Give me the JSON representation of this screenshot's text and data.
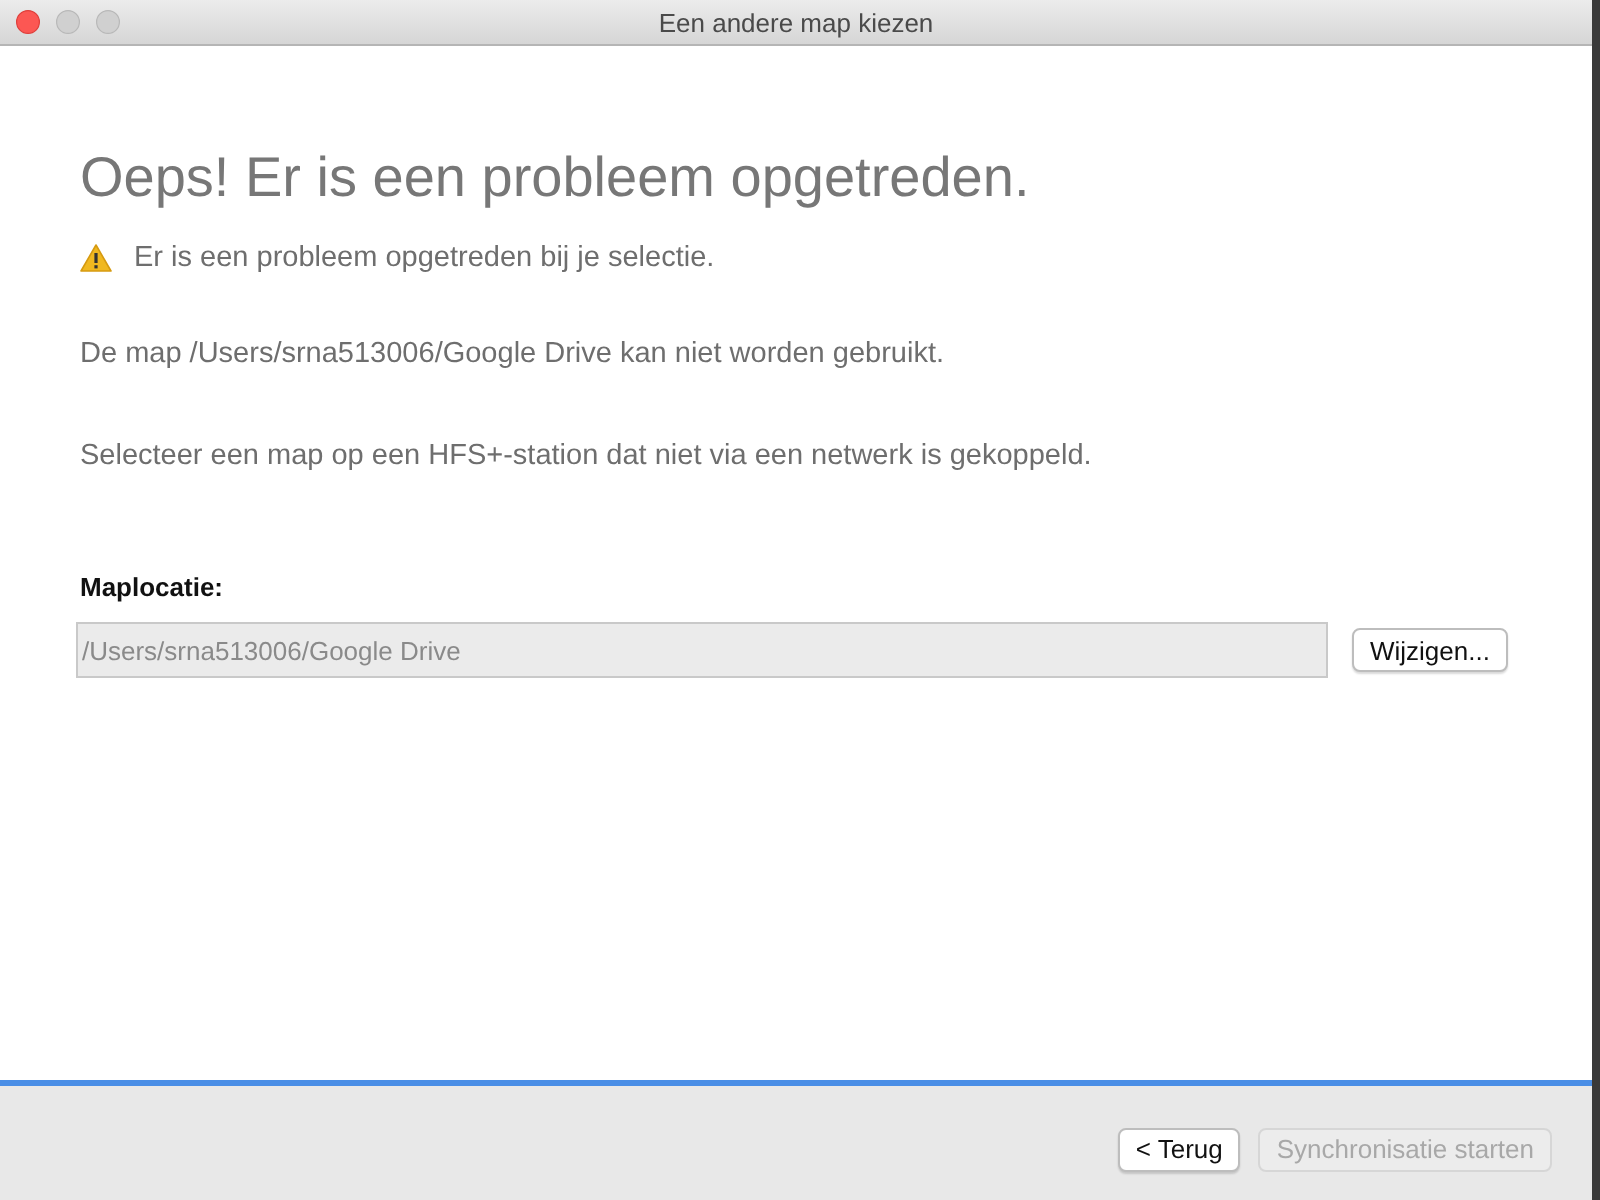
{
  "window": {
    "title": "Een andere map kiezen"
  },
  "heading": "Oeps! Er is een probleem opgetreden.",
  "warning": "Er is een probleem opgetreden bij je selectie.",
  "messages": [
    "De map /Users/srna513006/Google Drive kan niet worden gebruikt.",
    "Selecteer een map op een HFS+-station dat niet via een netwerk is gekoppeld."
  ],
  "folder": {
    "label": "Maplocatie:",
    "value": "/Users/srna513006/Google Drive",
    "disabled": true,
    "button": "Wijzigen..."
  },
  "footer_buttons": [
    {
      "label": "< Terug",
      "disabled": false
    },
    {
      "label": "Synchronisatie starten",
      "disabled": true
    }
  ]
}
